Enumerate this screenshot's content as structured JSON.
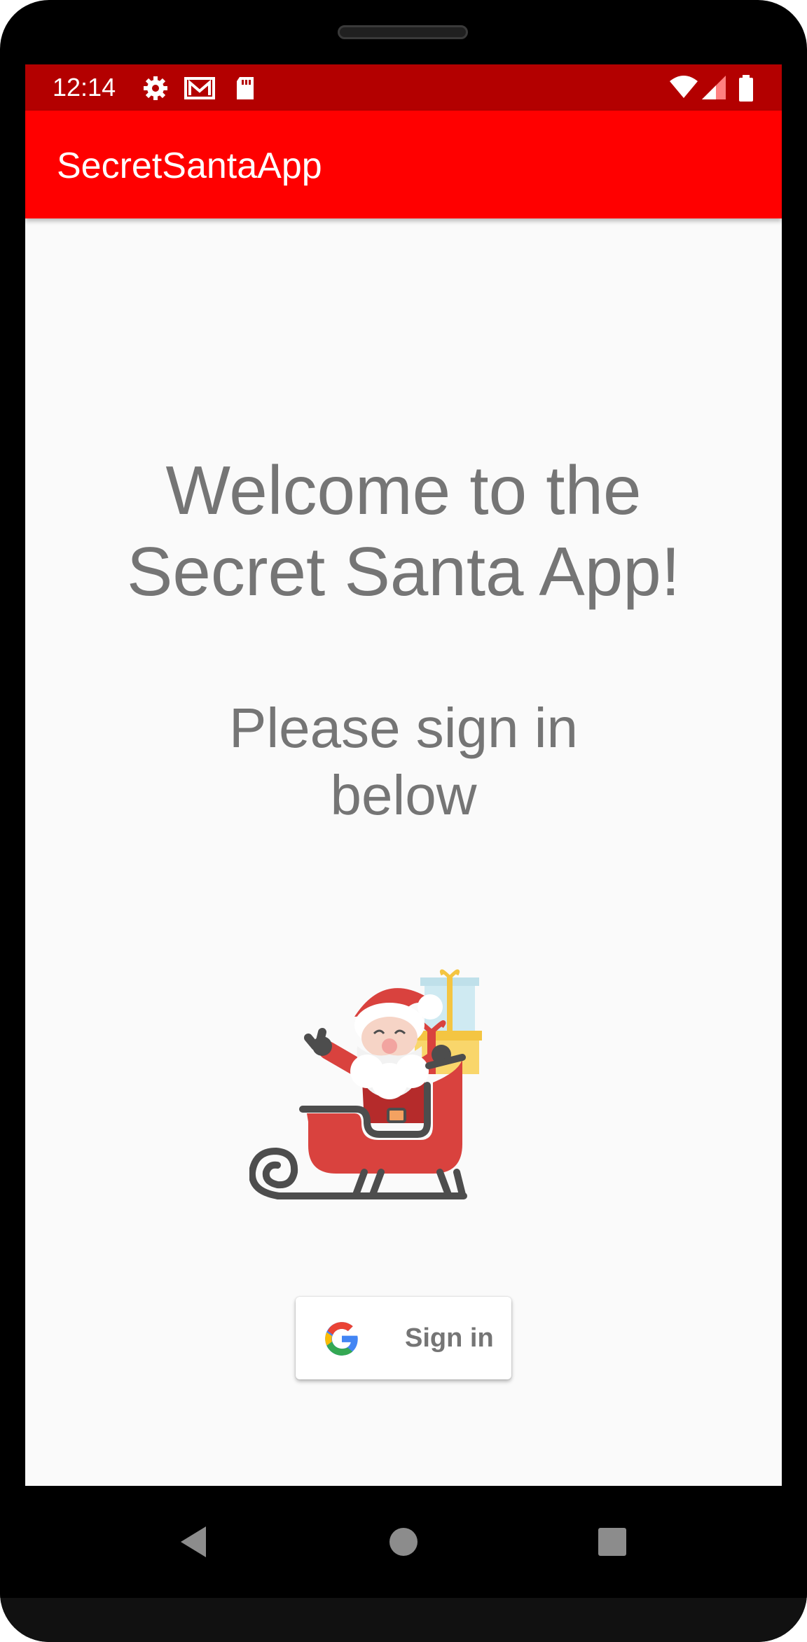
{
  "status_bar": {
    "time": "12:14",
    "background": "#b30000",
    "left_icons": [
      "gear-icon",
      "gmail-icon",
      "sd-card-icon"
    ],
    "right_icons": [
      "wifi-icon",
      "cell-signal-icon",
      "battery-icon"
    ]
  },
  "app_bar": {
    "title": "SecretSantaApp",
    "background": "#ff0000"
  },
  "main": {
    "welcome_text": "Welcome to the\nSecret Santa App!",
    "subtitle": "Please sign in\nbelow",
    "illustration": "santa-sleigh-illustration",
    "text_color": "#757575"
  },
  "signin": {
    "label": "Sign in",
    "icon": "google-logo-icon"
  },
  "nav_bar": {
    "buttons": [
      "back-icon",
      "home-icon",
      "recents-icon"
    ]
  }
}
